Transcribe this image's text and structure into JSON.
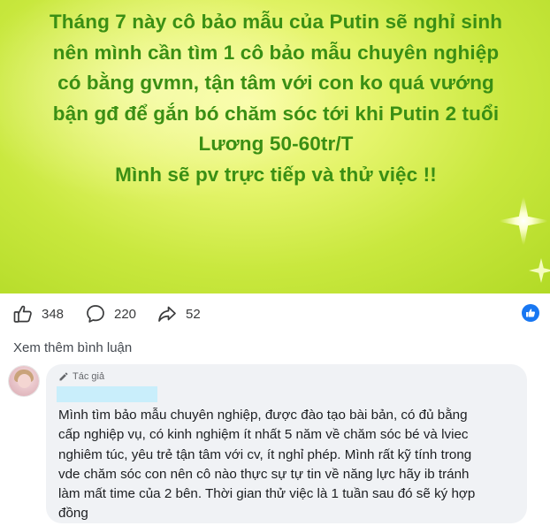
{
  "post": {
    "text_lines": [
      "Tháng 7 này cô bảo mẫu của Putin sẽ nghỉ sinh",
      "nên mình cần tìm 1 cô bảo mẫu chuyên nghiệp",
      "có bằng gvmn, tận tâm với con ko quá vướng",
      "bận gđ để gắn bó chăm sóc tới khi Putin 2 tuổi",
      "Lương 50-60tr/T",
      "Mình sẽ pv trực tiếp và thử việc !!"
    ],
    "text_color": "#3a8f14",
    "background_colors": [
      "#f8fca0",
      "#c9e83e",
      "#b2da26"
    ]
  },
  "reactions": {
    "likes": "348",
    "comments": "220",
    "shares": "52",
    "like_icon": "thumbs-up-icon",
    "comment_icon": "speech-bubble-icon",
    "share_icon": "share-arrow-icon",
    "badge_icon": "facebook-like-badge-icon",
    "badge_color": "#1877f2"
  },
  "comments_section": {
    "more_label": "Xem thêm bình luận"
  },
  "comment": {
    "badge_label": "Tác giả",
    "badge_icon": "pencil-icon",
    "text_lines": [
      "Mình tìm bảo mẫu chuyên nghiệp, được đào tạo bài bản, có đủ bằng",
      "cấp nghiệp vụ, có kinh nghiệm ít nhất 5 năm về chăm sóc bé và lviec",
      "nghiêm túc, yêu trẻ tận tâm với cv, ít nghỉ phép. Mình rất kỹ tính trong",
      "vde chăm sóc con nên cô nào thực sự tự tin về năng lực hãy ib tránh",
      "làm mất time của 2 bên. Thời gian thử việc là 1 tuần sau đó sẽ ký hợp",
      "đồng"
    ],
    "bubble_color": "#f0f2f5",
    "redaction_color": "#c9eefb"
  }
}
